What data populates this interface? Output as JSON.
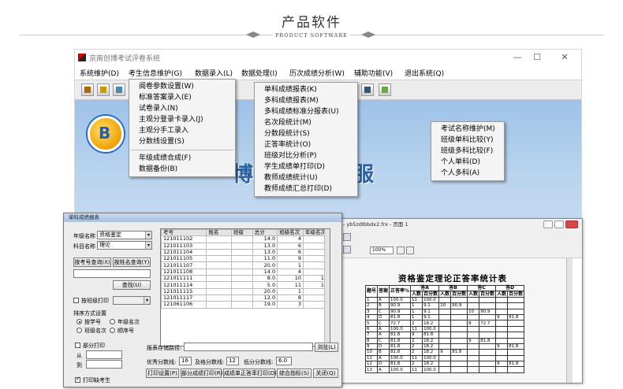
{
  "header": {
    "title": "产品软件",
    "subtitle": "PRODUCT SOFTWARE"
  },
  "main_window": {
    "title": "京南创博考试评卷系统",
    "controls": [
      "—",
      "☐",
      "✕"
    ],
    "menu": [
      "系统维护(D)",
      "考生信息维护(G)",
      "数据录入(L)",
      "数据处理(I)",
      "历次成绩分析(W)",
      "辅助功能(V)",
      "退出系统(Q)"
    ],
    "big_text": "博 测 评 服"
  },
  "menus": {
    "data_entry": [
      "阅卷参数设置(W)",
      "标准答案录入(E)",
      "试卷录入(N)",
      "主观分登录卡录入(J)",
      "主观分手工录入",
      "分数线设置(S)"
    ],
    "data_entry_extra": [
      "年级成绩合成(F)",
      "数据备份(B)"
    ],
    "data_processing": [
      "单科成绩报表(K)",
      "多科成绩报表(M)",
      "多科成绩标准分报表(U)",
      "名次段统计(M)",
      "分数段统计(S)",
      "正答率统计(O)",
      "班级对比分析(P)",
      "学生成绩单打印(D)",
      "教师成绩统计(U)",
      "教师成绩汇总打印(D)"
    ],
    "history": [
      "考试名称维护(M)",
      "班级单科比较(Y)",
      "班级多科比较(F)",
      "个人单科(D)",
      "个人多科(A)"
    ]
  },
  "win1": {
    "title": "单科成绩报表",
    "grade_label": "年级名称",
    "grade_value": "资格鉴定",
    "subject_label": "科目名称",
    "subject_value": "理论",
    "btn_query_no": "按考号查询(X)",
    "btn_query_name": "按姓名查询(Y)",
    "btn_find": "查找(U)",
    "chk_class_print": "按班级打印",
    "sort_label": "排序方式设置",
    "sort_options": [
      "按学号",
      "年级名次",
      "班级名次",
      "顺序号"
    ],
    "chk_partial": "部分打印",
    "from_label": "从",
    "to_label": "到",
    "chk_absent": "打印缺考生",
    "columns": [
      "考号",
      "姓名",
      "班级",
      "总分",
      "班级名次",
      "年级名次"
    ],
    "rows": [
      [
        "121011102",
        "",
        "",
        "14.0",
        "4",
        "4"
      ],
      [
        "121011103",
        "",
        "",
        "13.0",
        "6",
        "6"
      ],
      [
        "121011104",
        "",
        "",
        "13.0",
        "6",
        "6"
      ],
      [
        "121011105",
        "",
        "",
        "11.0",
        "9",
        "9"
      ],
      [
        "121011107",
        "",
        "",
        "20.0",
        "1",
        "1"
      ],
      [
        "121011108",
        "",
        "",
        "14.0",
        "4",
        "4"
      ],
      [
        "121011111",
        "",
        "",
        "8.0",
        "10",
        "10"
      ],
      [
        "121011114",
        "",
        "",
        "5.0",
        "11",
        "11"
      ],
      [
        "121011115",
        "",
        "",
        "20.0",
        "1",
        "1"
      ],
      [
        "121011117",
        "",
        "",
        "12.0",
        "8",
        "8"
      ],
      [
        "121061106",
        "",
        "",
        "19.0",
        "3",
        "3"
      ]
    ],
    "path_label": "报表存储路径:",
    "btn_browse": "浏览(L)",
    "excellent_label": "优秀分数线:",
    "excellent_value": "16",
    "pass_label": "及格分数线:",
    "pass_value": "12",
    "low_label": "低分分数线:",
    "low_value": "6.0",
    "buttons": [
      "打印设置(P)",
      "部分成绩打印(R)",
      "成绩单正答率打印(D)",
      "综合指标(S)",
      "关闭(Q)"
    ]
  },
  "win2": {
    "title": "- yb5zdlbbdx2.frx - 页面 1",
    "zoom": "100%",
    "report_title": "资格鉴定理论正答率统计表",
    "head1": [
      "题号",
      "答案",
      "正答率%",
      "答A",
      "答B",
      "答C",
      "答D"
    ],
    "head2": [
      "人数",
      "百分数",
      "人数",
      "百分数",
      "人数",
      "百分数",
      "人数",
      "百分数"
    ],
    "rows": [
      [
        "1",
        "A",
        "100.0",
        "11",
        "100.0",
        "",
        "",
        "",
        "",
        "",
        ""
      ],
      [
        "2",
        "B",
        "90.9",
        "1",
        "9.1",
        "10",
        "90.9",
        "",
        "",
        "",
        ""
      ],
      [
        "3",
        "C",
        "90.9",
        "1",
        "9.1",
        "",
        "",
        "10",
        "90.9",
        "",
        ""
      ],
      [
        "4",
        "D",
        "81.8",
        "1",
        "9.1",
        "",
        "",
        "",
        "",
        "9",
        "81.8"
      ],
      [
        "5",
        "C",
        "72.7",
        "2",
        "18.2",
        "",
        "",
        "8",
        "72.7",
        "",
        ""
      ],
      [
        "6",
        "A",
        "100.0",
        "11",
        "100.0",
        "",
        "",
        "",
        "",
        "",
        ""
      ],
      [
        "7",
        "A",
        "81.8",
        "9",
        "81.8",
        "",
        "",
        "",
        "",
        "",
        ""
      ],
      [
        "8",
        "C",
        "81.8",
        "2",
        "18.2",
        "",
        "",
        "9",
        "81.8",
        "",
        ""
      ],
      [
        "9",
        "D",
        "81.8",
        "2",
        "18.2",
        "",
        "",
        "",
        "",
        "9",
        "81.8"
      ],
      [
        "10",
        "B",
        "81.8",
        "2",
        "18.2",
        "9",
        "81.8",
        "",
        "",
        "",
        ""
      ],
      [
        "11",
        "A",
        "100.0",
        "11",
        "100.0",
        "",
        "",
        "",
        "",
        "",
        ""
      ],
      [
        "12",
        "D",
        "81.8",
        "2",
        "18.2",
        "",
        "",
        "",
        "",
        "9",
        "81.8"
      ],
      [
        "13",
        "A",
        "100.0",
        "11",
        "100.0",
        "",
        "",
        "",
        "",
        "",
        ""
      ]
    ]
  }
}
